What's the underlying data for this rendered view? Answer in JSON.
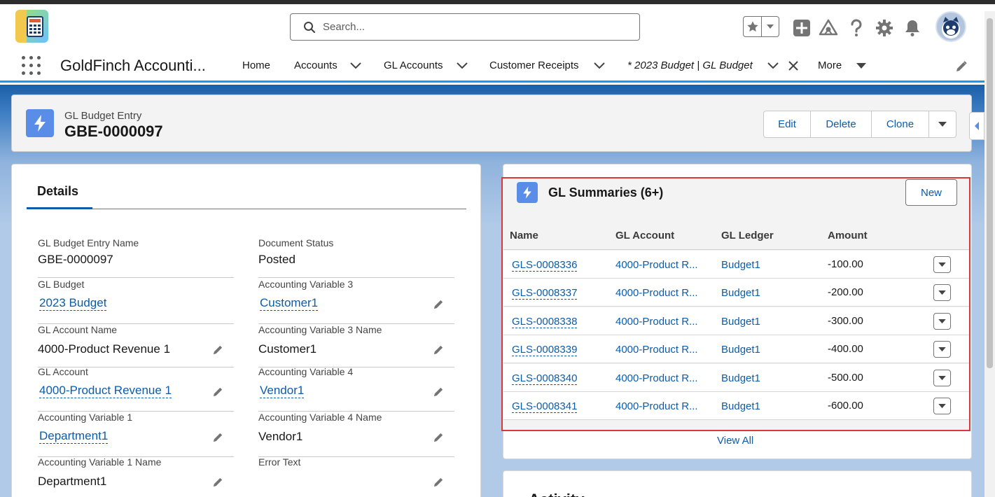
{
  "search": {
    "placeholder": "Search..."
  },
  "app": {
    "name": "GoldFinch Accounti..."
  },
  "nav": {
    "items": [
      {
        "label": "Home"
      },
      {
        "label": "Accounts"
      },
      {
        "label": "GL Accounts"
      },
      {
        "label": "Customer Receipts"
      },
      {
        "label": "* 2023 Budget | GL Budget"
      },
      {
        "label": "More"
      }
    ]
  },
  "record": {
    "type": "GL Budget Entry",
    "name": "GBE-0000097",
    "actions": [
      "Edit",
      "Delete",
      "Clone"
    ]
  },
  "details": {
    "tab": "Details",
    "fields": [
      {
        "label": "GL Budget Entry Name",
        "value": "GBE-0000097"
      },
      {
        "label": "Document Status",
        "value": "Posted"
      },
      {
        "label": "GL Budget",
        "value": "2023 Budget"
      },
      {
        "label": "Accounting Variable 3",
        "value": "Customer1"
      },
      {
        "label": "GL Account Name",
        "value": "4000-Product Revenue 1"
      },
      {
        "label": "Accounting Variable 3 Name",
        "value": "Customer1"
      },
      {
        "label": "GL Account",
        "value": "4000-Product Revenue 1"
      },
      {
        "label": "Accounting Variable 4",
        "value": "Vendor1"
      },
      {
        "label": "Accounting Variable 1",
        "value": "Department1"
      },
      {
        "label": "Accounting Variable 4 Name",
        "value": "Vendor1"
      },
      {
        "label": "Accounting Variable 1 Name",
        "value": "Department1"
      },
      {
        "label": "Error Text",
        "value": ""
      }
    ]
  },
  "summaries": {
    "title": "GL Summaries (6+)",
    "new_label": "New",
    "columns": [
      "Name",
      "GL Account",
      "GL Ledger",
      "Amount"
    ],
    "rows": [
      {
        "name": "GLS-0008336",
        "account": "4000-Product R...",
        "ledger": "Budget1",
        "amount": "-100.00"
      },
      {
        "name": "GLS-0008337",
        "account": "4000-Product R...",
        "ledger": "Budget1",
        "amount": "-200.00"
      },
      {
        "name": "GLS-0008338",
        "account": "4000-Product R...",
        "ledger": "Budget1",
        "amount": "-300.00"
      },
      {
        "name": "GLS-0008339",
        "account": "4000-Product R...",
        "ledger": "Budget1",
        "amount": "-400.00"
      },
      {
        "name": "GLS-0008340",
        "account": "4000-Product R...",
        "ledger": "Budget1",
        "amount": "-500.00"
      },
      {
        "name": "GLS-0008341",
        "account": "4000-Product R...",
        "ledger": "Budget1",
        "amount": "-600.00"
      }
    ],
    "view_all": "View All"
  },
  "activity": {
    "title": "Activity"
  },
  "colors": {
    "link": "#0b5cab",
    "brand_blue": "#1b96ff",
    "highlight_red": "#d9393b",
    "object_icon": "#5a8de8"
  }
}
